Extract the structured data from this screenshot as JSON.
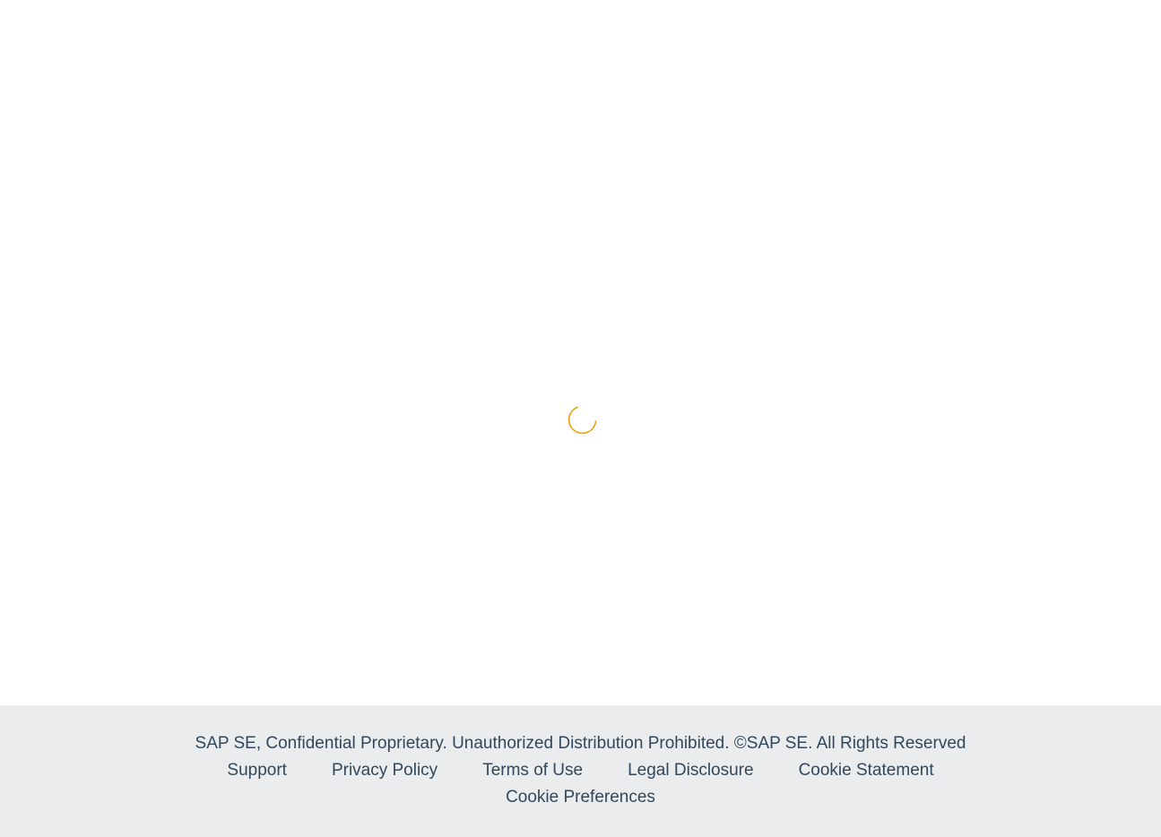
{
  "loading": {
    "icon": "busy-spinner-icon",
    "color": "#e9a210"
  },
  "footer": {
    "copyright": "SAP SE, Confidential Proprietary. Unauthorized Distribution Prohibited. ©SAP SE. All Rights Reserved",
    "links": {
      "support": "Support",
      "privacy_policy": "Privacy Policy",
      "terms_of_use": "Terms of Use",
      "legal_disclosure": "Legal Disclosure",
      "cookie_statement": "Cookie Statement",
      "cookie_preferences": "Cookie Preferences"
    },
    "background": "#eaecee",
    "text_color": "#32475b"
  }
}
